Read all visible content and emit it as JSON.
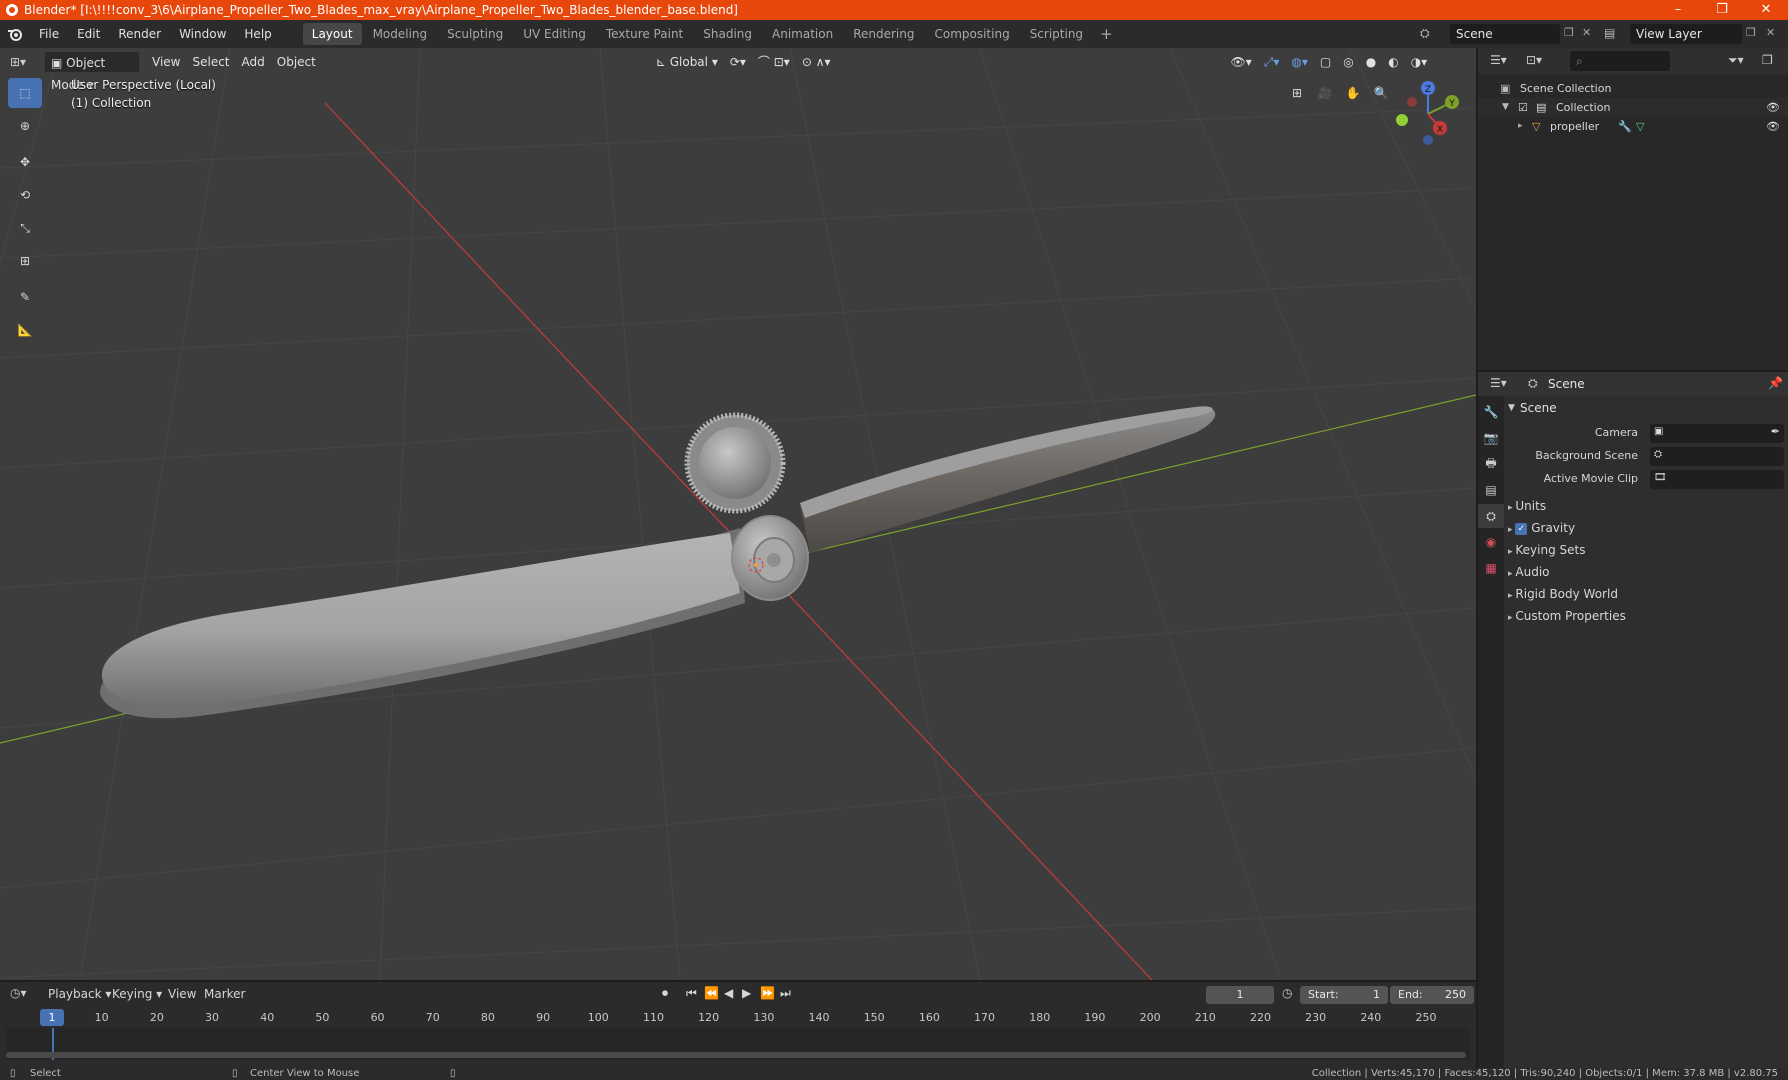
{
  "window": {
    "title": "Blender* [I:\\!!!!conv_3\\6\\Airplane_Propeller_Two_Blades_max_vray\\Airplane_Propeller_Two_Blades_blender_base.blend]",
    "minimize": "–",
    "restore": "❐",
    "close": "✕"
  },
  "menus": [
    "File",
    "Edit",
    "Render",
    "Window",
    "Help"
  ],
  "workspaces": [
    "Layout",
    "Modeling",
    "Sculpting",
    "UV Editing",
    "Texture Paint",
    "Shading",
    "Animation",
    "Rendering",
    "Compositing",
    "Scripting"
  ],
  "active_workspace": "Layout",
  "scene_field": "Scene",
  "view_layer_field": "View Layer",
  "viewport": {
    "mode": "Object Mode",
    "menus": [
      "View",
      "Select",
      "Add",
      "Object"
    ],
    "orientation": "Global",
    "info_line1": "User Perspective (Local)",
    "info_line2": "(1) Collection",
    "gizmo": {
      "z": "Z",
      "y": "Y",
      "x": "X"
    }
  },
  "outliner": {
    "rows": [
      {
        "label": "Scene Collection",
        "icon": "scene-collection-icon"
      },
      {
        "label": "Collection",
        "icon": "collection-icon",
        "checked": true
      },
      {
        "label": "propeller",
        "icon": "mesh-object-icon"
      }
    ]
  },
  "properties": {
    "header_title": "Scene",
    "panel_title": "Scene",
    "fields": [
      {
        "label": "Camera"
      },
      {
        "label": "Background Scene"
      },
      {
        "label": "Active Movie Clip"
      }
    ],
    "subpanels": [
      "Units",
      "Gravity",
      "Keying Sets",
      "Audio",
      "Rigid Body World",
      "Custom Properties"
    ],
    "gravity_checked": true
  },
  "timeline": {
    "menus": [
      "Playback",
      "Keying",
      "View",
      "Marker"
    ],
    "current_frame": "1",
    "start_label": "Start:",
    "start_value": "1",
    "end_label": "End:",
    "end_value": "250",
    "ruler": [
      "1",
      "10",
      "20",
      "30",
      "40",
      "50",
      "60",
      "70",
      "80",
      "90",
      "100",
      "110",
      "120",
      "130",
      "140",
      "150",
      "160",
      "170",
      "180",
      "190",
      "200",
      "210",
      "220",
      "230",
      "240",
      "250"
    ]
  },
  "statusbar": {
    "left": "Select",
    "middle": "Center View to Mouse",
    "right": "Collection | Verts:45,170 | Faces:45,120 | Tris:90,240 | Objects:0/1 | Mem: 37.8 MB | v2.80.75"
  },
  "colors": {
    "titlebar": "#e8470c",
    "accent": "#4772b3",
    "x_axis": "#c83a3a",
    "y_axis": "#7ca12a"
  }
}
